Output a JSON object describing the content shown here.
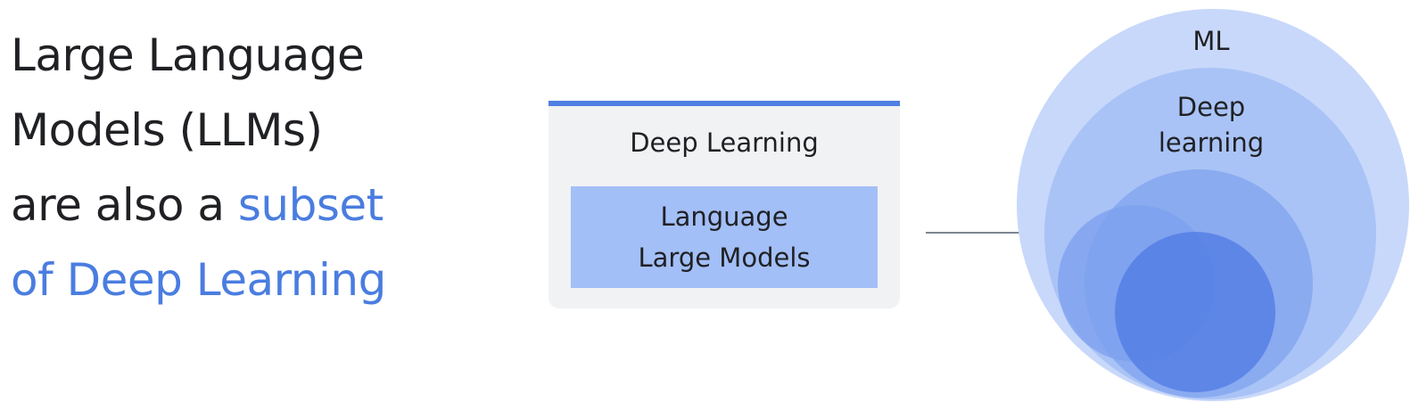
{
  "headline": {
    "line1": "Large Language",
    "line2": "Models (LLMs)",
    "line3_prefix": "are also a ",
    "line3_accent": "subset",
    "line4_accent": "of Deep Learning"
  },
  "card": {
    "title": "Deep Learning",
    "inner_line1": "Language",
    "inner_line2": "Large Models"
  },
  "venn": {
    "outer_label": "ML",
    "middle_label_line1": "Deep",
    "middle_label_line2": "learning"
  },
  "colors": {
    "accent_text": "#4a7de0",
    "card_bar": "#4f7fe2",
    "card_bg": "#f1f2f4",
    "card_inner": "#a3bff7",
    "venn_outer": "#c8d8fa",
    "venn_middle": "#a9c3f6",
    "venn_inner": "#5f89ea"
  }
}
